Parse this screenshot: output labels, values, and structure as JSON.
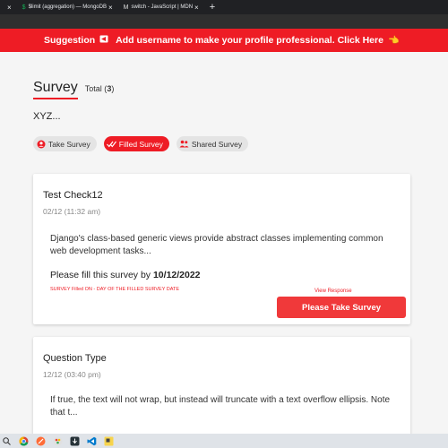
{
  "browser": {
    "tabs": [
      {
        "label": "",
        "close": "×"
      },
      {
        "label": "$limit (aggregation) — MongoDB",
        "favicon": "$",
        "close": "×"
      },
      {
        "label": "switch - JavaScript | MDN",
        "favicon": "M",
        "close": "×"
      }
    ],
    "new_tab": "+"
  },
  "banner": {
    "label": "Suggestion",
    "speaker_icon": "speaker-icon",
    "message": "Add username to make your profile professional. Click Here",
    "hand_icon": "pointing-hand-icon"
  },
  "page": {
    "title": "Survey",
    "total_label": "Total (",
    "total_count": "3",
    "total_suffix": ")",
    "subtitle": "XYZ..."
  },
  "tabs": [
    {
      "label": "Take Survey",
      "icon": "user-circle-icon",
      "active": false
    },
    {
      "label": "Filled Survey",
      "icon": "double-check-icon",
      "active": true
    },
    {
      "label": "Shared Survey",
      "icon": "people-icon",
      "active": false
    }
  ],
  "cards": [
    {
      "title": "Test Check12",
      "date": "02/12 (11:32 am)",
      "description": "Django's class-based generic views provide abstract classes implementing common web development tasks...",
      "fill_prefix": "Please fill this survey by ",
      "fill_date": "10/12/2022",
      "filled_on": "SURVEY Filled ON - DAY OF THE FILLED SURVEY DATE",
      "view_response": "View Response",
      "button": "Please Take Survey"
    },
    {
      "title": "Question Type",
      "date": "12/12 (03:40 pm)",
      "description": "If true, the text will not wrap, but instead will truncate with a text overflow ellipsis. Note that t..."
    }
  ],
  "colors": {
    "accent": "#ee1c25",
    "button": "#f0393a",
    "tabbar": "#202124"
  }
}
